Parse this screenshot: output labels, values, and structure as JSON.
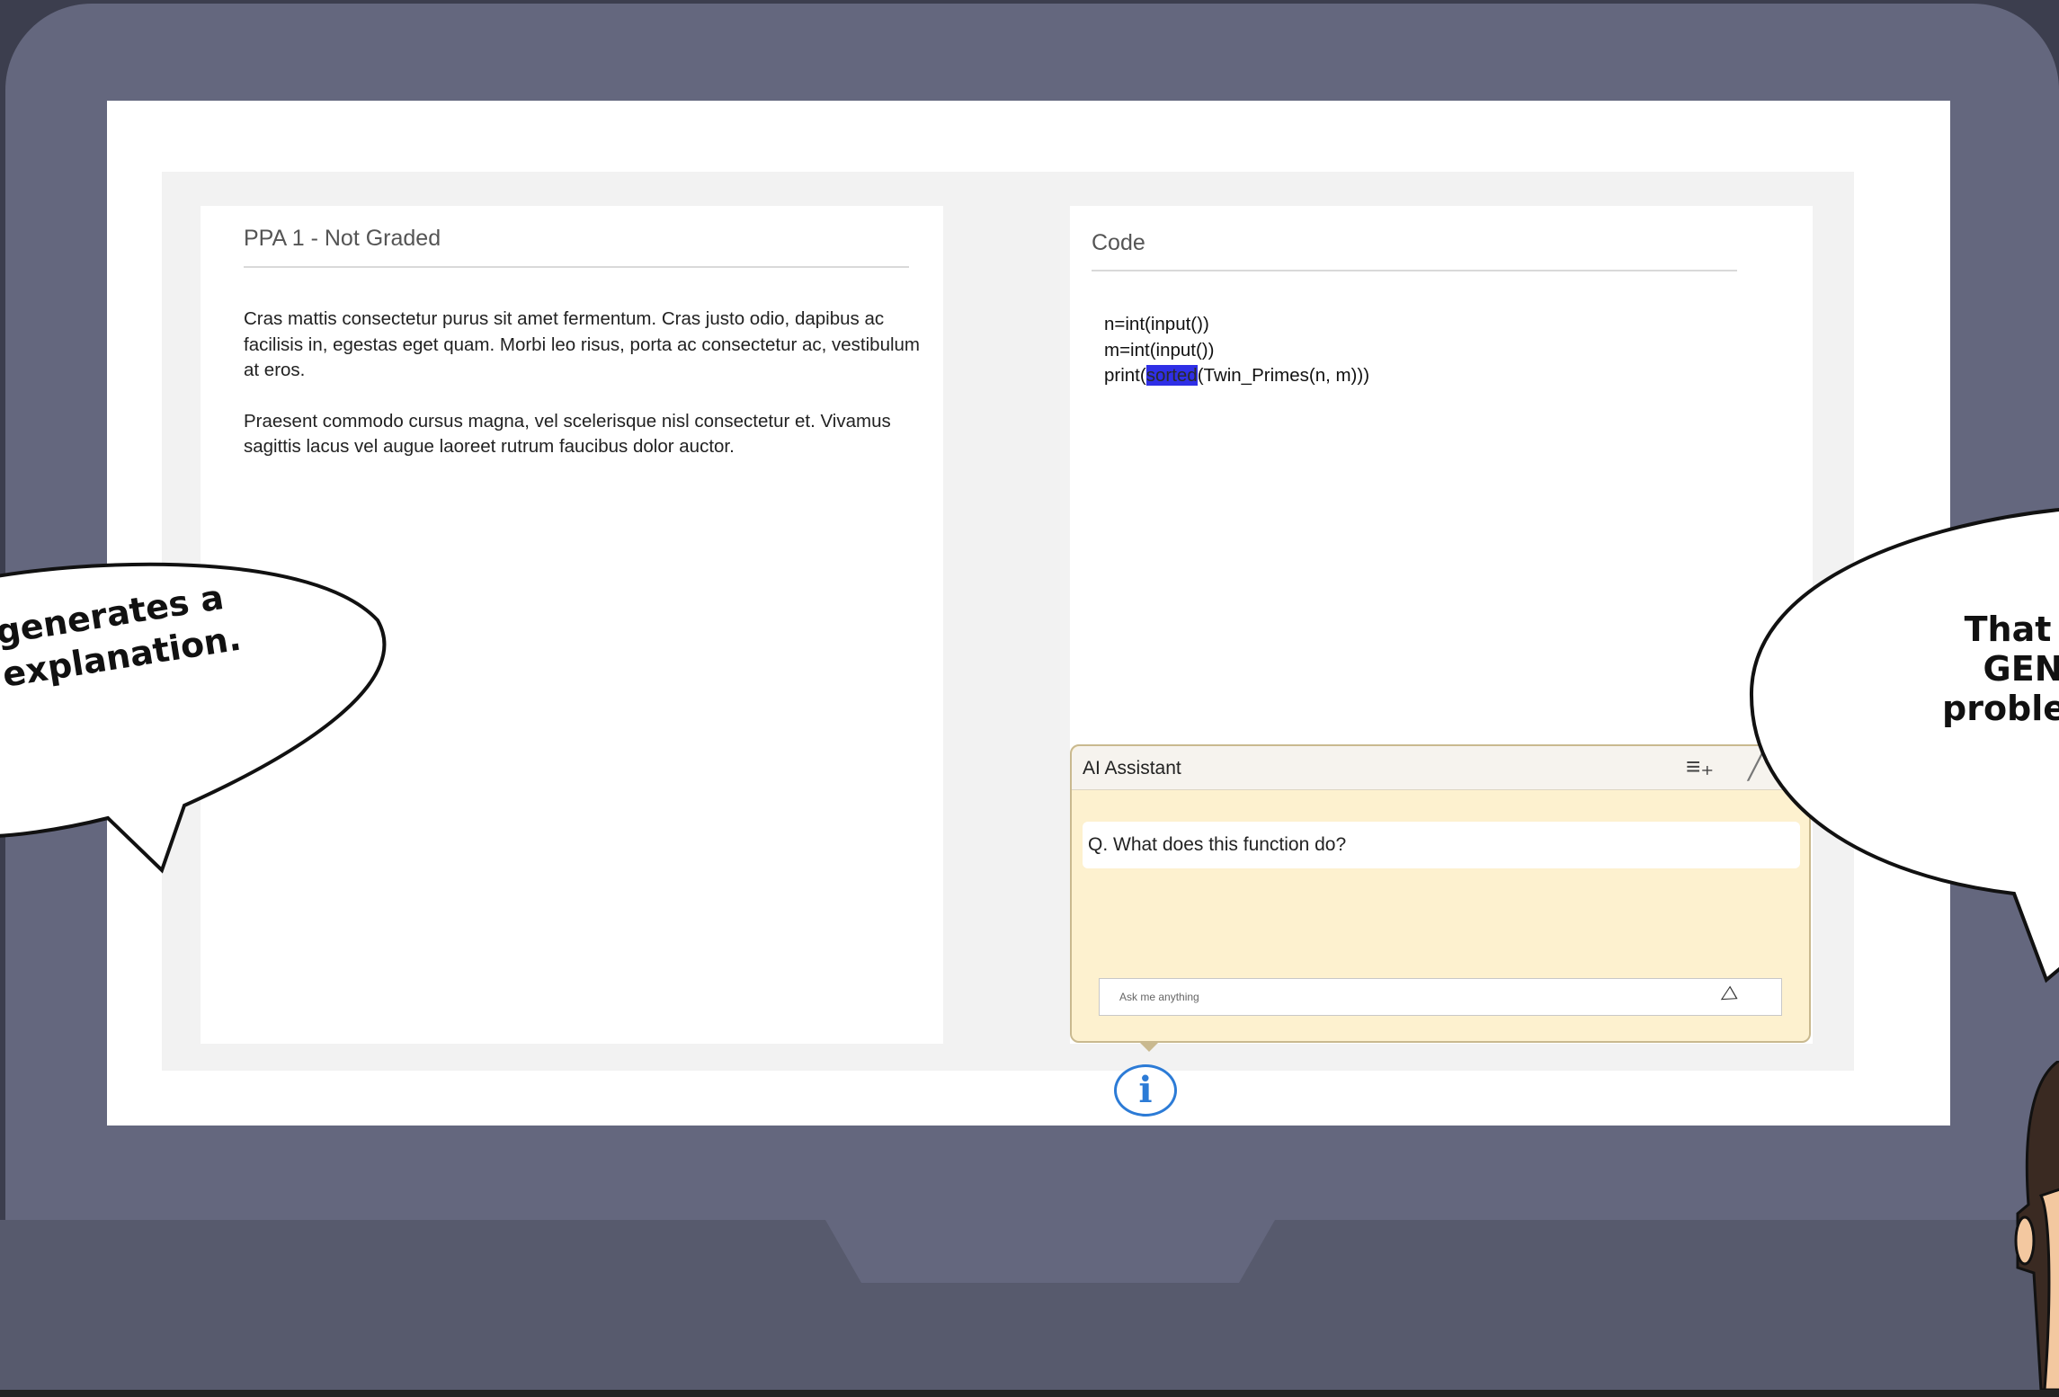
{
  "problem_panel": {
    "title": "PPA 1 - Not Graded",
    "paragraphs": [
      "Cras mattis consectetur purus sit amet fermentum. Cras justo odio, dapibus ac facilisis in, egestas eget quam. Morbi leo risus, porta ac consectetur ac, vestibulum at eros.",
      "Praesent commodo cursus magna, vel scelerisque nisl consectetur et. Vivamus sagittis lacus vel augue laoreet rutrum faucibus dolor auctor."
    ]
  },
  "code_panel": {
    "title": "Code",
    "lines": {
      "line1": "n=int(input())",
      "line2": "m=int(input())",
      "line3_prefix": "print(",
      "line3_highlight": "sorted",
      "line3_suffix": "(Twin_Primes(n, m)))"
    }
  },
  "ai_assistant": {
    "title": "AI Assistant",
    "question": "Q. What does this function do?",
    "input_placeholder": "Ask me anything",
    "icons": {
      "new_chat": "list-plus-icon",
      "close": "close-icon",
      "send": "send-icon",
      "info": "info-icon"
    }
  },
  "bubbles": {
    "left": {
      "line1": "generates a",
      "line2": "explanation."
    },
    "right": {
      "line1": "That",
      "line2": "GEN",
      "line3": "proble"
    }
  },
  "colors": {
    "laptop_frame": "#64677e",
    "popup_background": "#fdf1cf",
    "highlight": "#2f2fe6",
    "info_blue": "#2c7bd6"
  }
}
